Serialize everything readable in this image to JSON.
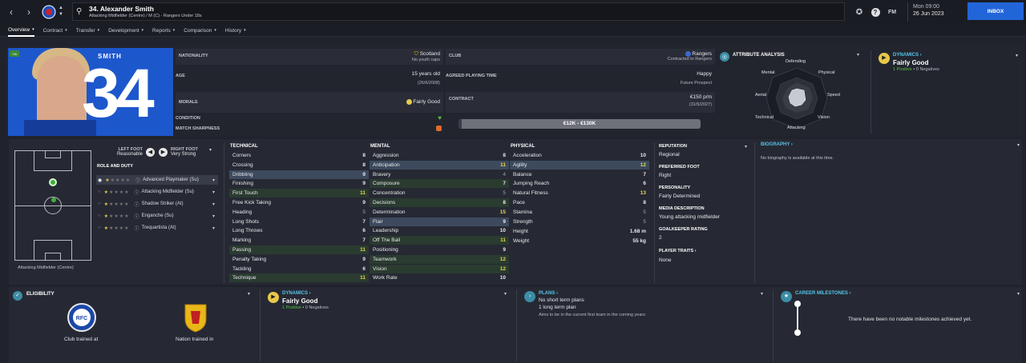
{
  "header": {
    "player_title": "34. Alexander Smith",
    "player_sub": "Attacking Midfielder (Centre) / M (C) - Rangers Under 18s",
    "fm_label": "FM",
    "time": "Mon 09:00",
    "date": "26 Jun 2023",
    "inbox_label": "INBOX"
  },
  "tabs": [
    {
      "label": "Overview"
    },
    {
      "label": "Contract"
    },
    {
      "label": "Transfer"
    },
    {
      "label": "Development"
    },
    {
      "label": "Reports"
    },
    {
      "label": "Comparison"
    },
    {
      "label": "History"
    }
  ],
  "hero": {
    "name": "SMITH",
    "number": "34",
    "badge": "Yth"
  },
  "info": {
    "nationality_label": "NATIONALITY",
    "nationality": "Scotland",
    "youth_caps": "No youth caps",
    "club_label": "CLUB",
    "club": "Rangers",
    "club_contract": "Contracted to Rangers",
    "age_label": "AGE",
    "age": "15 years old",
    "dob": "(26/6/2008)",
    "apt_label": "AGREED PLAYING TIME",
    "apt": "Happy",
    "apt_sub": "Future Prospect",
    "morale_label": "MORALE",
    "morale": "Fairly Good",
    "contract_label": "CONTRACT",
    "wage": "€150 p/m",
    "contract_end": "(31/5/2027)",
    "condition_label": "CONDITION",
    "sharpness_label": "MATCH SHARPNESS",
    "value_range": "€12K - €130K"
  },
  "attr_analysis": {
    "title": "ATTRIBUTE ANALYSIS",
    "labels": [
      "Defending",
      "Physical",
      "Speed",
      "Vision",
      "Attacking",
      "Technical",
      "Aerial",
      "Mental"
    ]
  },
  "dynamics_top": {
    "title": "DYNAMICS",
    "value": "Fairly Good",
    "positive": "1 Positive",
    "sep": "•",
    "negative": "0 Negatives"
  },
  "feet": {
    "left_label": "LEFT FOOT",
    "left_value": "Reasonable",
    "right_label": "RIGHT FOOT",
    "right_value": "Very Strong"
  },
  "role_duty_label": "ROLE AND DUTY",
  "roles": [
    {
      "label": "Advanced Playmaker (Su)",
      "stars": 1.5
    },
    {
      "label": "Attacking Midfielder (Su)",
      "stars": 1.5
    },
    {
      "label": "Shadow Striker (At)",
      "stars": 1.5
    },
    {
      "label": "Enganche (Su)",
      "stars": 1.5
    },
    {
      "label": "Trequartista (At)",
      "stars": 1.5
    }
  ],
  "position_label": "Attacking Midfielder (Centre)",
  "technical": {
    "title": "TECHNICAL",
    "rows": [
      {
        "name": "Corners",
        "value": "8"
      },
      {
        "name": "Crossing",
        "value": "8"
      },
      {
        "name": "Dribbling",
        "value": "9"
      },
      {
        "name": "Finishing",
        "value": "9"
      },
      {
        "name": "First Touch",
        "value": "11"
      },
      {
        "name": "Free Kick Taking",
        "value": "9"
      },
      {
        "name": "Heading",
        "value": "5"
      },
      {
        "name": "Long Shots",
        "value": "7"
      },
      {
        "name": "Long Throws",
        "value": "6"
      },
      {
        "name": "Marking",
        "value": "7"
      },
      {
        "name": "Passing",
        "value": "11"
      },
      {
        "name": "Penalty Taking",
        "value": "9"
      },
      {
        "name": "Tackling",
        "value": "6"
      },
      {
        "name": "Technique",
        "value": "11"
      }
    ]
  },
  "mental": {
    "title": "MENTAL",
    "rows": [
      {
        "name": "Aggression",
        "value": "8"
      },
      {
        "name": "Anticipation",
        "value": "11"
      },
      {
        "name": "Bravery",
        "value": "4"
      },
      {
        "name": "Composure",
        "value": "7"
      },
      {
        "name": "Concentration",
        "value": "5"
      },
      {
        "name": "Decisions",
        "value": "8"
      },
      {
        "name": "Determination",
        "value": "15"
      },
      {
        "name": "Flair",
        "value": "9"
      },
      {
        "name": "Leadership",
        "value": "10"
      },
      {
        "name": "Off The Ball",
        "value": "11"
      },
      {
        "name": "Positioning",
        "value": "9"
      },
      {
        "name": "Teamwork",
        "value": "12"
      },
      {
        "name": "Vision",
        "value": "12"
      },
      {
        "name": "Work Rate",
        "value": "10"
      }
    ]
  },
  "physical": {
    "title": "PHYSICAL",
    "rows": [
      {
        "name": "Acceleration",
        "value": "10"
      },
      {
        "name": "Agility",
        "value": "12"
      },
      {
        "name": "Balance",
        "value": "7"
      },
      {
        "name": "Jumping Reach",
        "value": "6"
      },
      {
        "name": "Natural Fitness",
        "value": "13"
      },
      {
        "name": "Pace",
        "value": "8"
      },
      {
        "name": "Stamina",
        "value": "5"
      },
      {
        "name": "Strength",
        "value": "5"
      }
    ],
    "height_label": "Height",
    "height": "1.68 m",
    "weight_label": "Weight",
    "weight": "55 kg"
  },
  "profile": {
    "reputation_label": "REPUTATION",
    "reputation": "Regional",
    "foot_label": "PREFERRED FOOT",
    "foot": "Right",
    "personality_label": "PERSONALITY",
    "personality": "Fairly Determined",
    "media_label": "MEDIA DESCRIPTION",
    "media": "Young attacking midfielder",
    "gk_label": "GOALKEEPER RATING",
    "gk": "2",
    "traits_label": "PLAYER TRAITS",
    "traits": "None"
  },
  "biography": {
    "title": "BIOGRAPHY",
    "text": "No biography is available at this time."
  },
  "eligibility": {
    "title": "ELIGIBILITY",
    "club_trained": "Club trained at",
    "nation_trained": "Nation trained in"
  },
  "dynamics_bottom": {
    "title": "DYNAMICS",
    "value": "Fairly Good",
    "positive": "1 Positive",
    "sep": "•",
    "negative": "0 Negatives"
  },
  "plans": {
    "title": "PLANS",
    "line1": "No short term plans",
    "line2": "1 long term plan",
    "line3": "Aims to be in the current first team in the coming years"
  },
  "milestones": {
    "title": "CAREER MILESTONES",
    "text": "There have been no notable milestones achieved yet."
  },
  "colors": {
    "accent": "#2265d8",
    "hero_bg": "#1d57cc",
    "highlight": "#3d4a5e",
    "green_highlight": "#2a3b30",
    "positive": "#58c040"
  }
}
